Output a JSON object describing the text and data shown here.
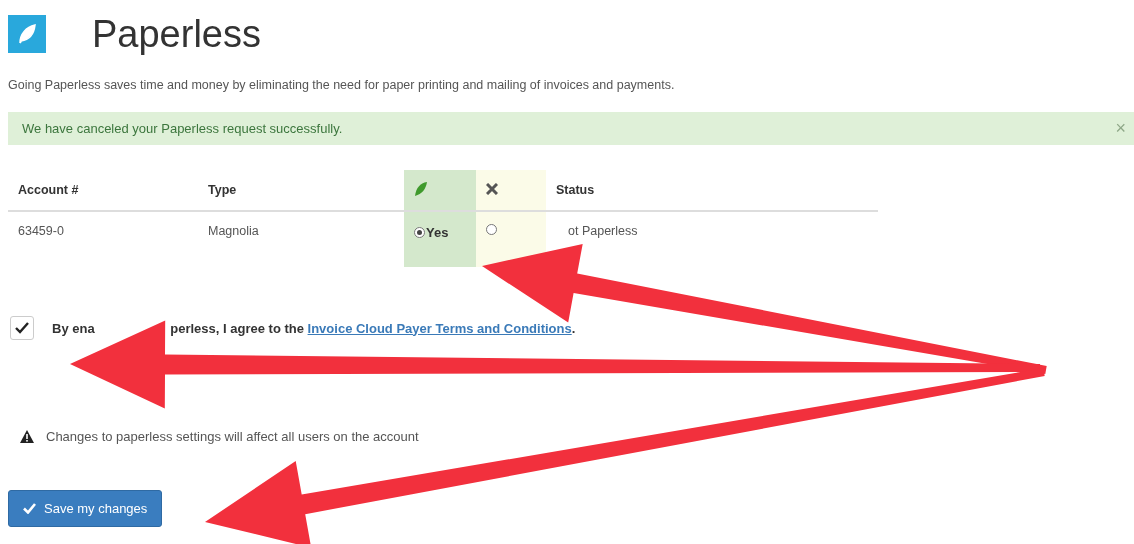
{
  "header": {
    "title": "Paperless",
    "description": "Going Paperless saves time and money by eliminating the need for paper printing and mailing of invoices and payments."
  },
  "alert": {
    "message": "We have canceled your Paperless request successfully.",
    "dismiss": "×"
  },
  "table": {
    "columns": [
      {
        "kind": "text",
        "label": "Account #"
      },
      {
        "kind": "text",
        "label": "Type"
      },
      {
        "kind": "leaf"
      },
      {
        "kind": "cross"
      },
      {
        "kind": "text",
        "label": "Status"
      }
    ],
    "rows": [
      {
        "account": "63459-0",
        "type": "Magnolia",
        "options": [
          {
            "label": "Yes",
            "selected": true
          },
          {
            "selected": false
          }
        ],
        "status": "ot Paperless"
      }
    ]
  },
  "agreement": {
    "checked": true,
    "parts": [
      "By ena",
      "perless, I agree to the"
    ],
    "link": "Invoice Cloud Payer Terms and Conditions",
    "end": "."
  },
  "warning": "Changes to paperless settings will affect all users on the account",
  "save_button": "Save my changes"
}
